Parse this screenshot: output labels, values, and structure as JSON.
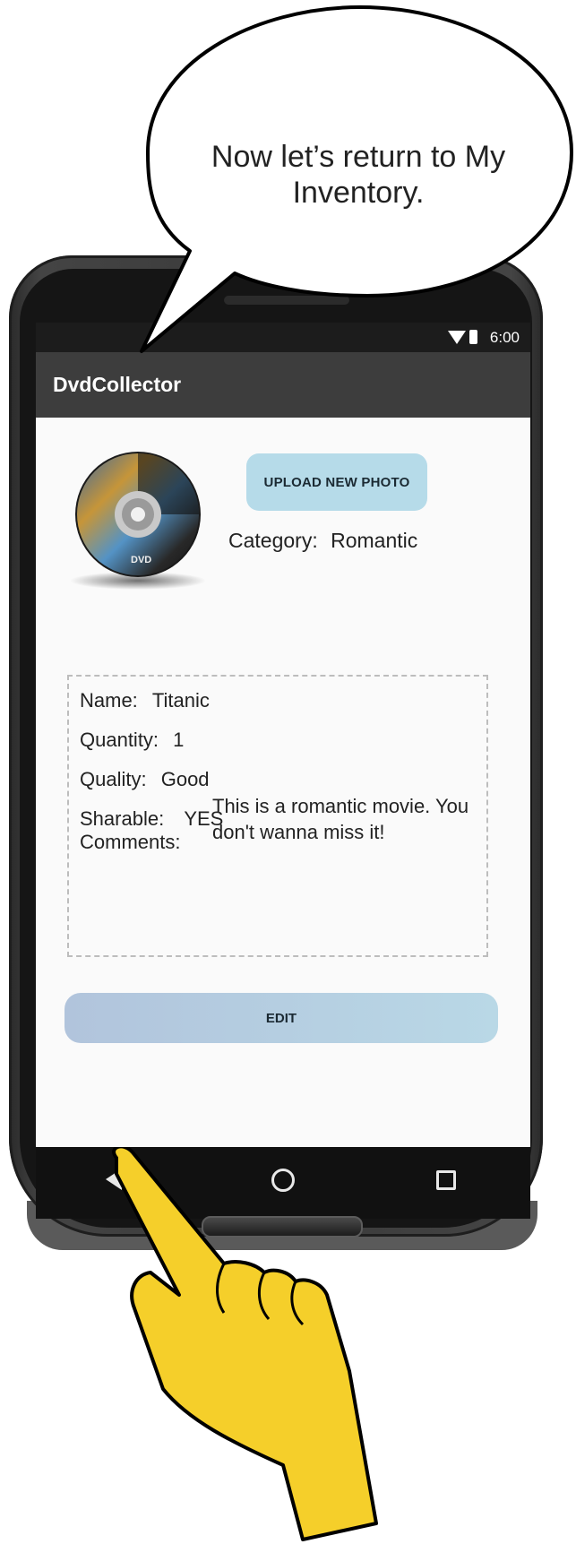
{
  "bubble": {
    "text": "Now let’s return to My Inventory."
  },
  "status_bar": {
    "time": "6:00"
  },
  "app_bar": {
    "title": "DvdCollector"
  },
  "photo": {
    "upload_label": "UPLOAD NEW PHOTO",
    "icon": "dvd-disc-icon",
    "disc_label": "DVD"
  },
  "category": {
    "label": "Category:",
    "value": "Romantic"
  },
  "details": {
    "name": {
      "label": "Name:",
      "value": "Titanic"
    },
    "quantity": {
      "label": "Quantity:",
      "value": "1"
    },
    "quality": {
      "label": "Quality:",
      "value": "Good"
    },
    "sharable": {
      "label": "Sharable:",
      "value": "YES"
    },
    "comments": {
      "label": "Comments:",
      "value": "This is a romantic movie. You don't wanna miss it!"
    }
  },
  "edit_label": "EDIT",
  "nav_bar": {
    "back": "back-icon",
    "home": "home-icon",
    "recents": "recents-icon"
  },
  "colors": {
    "app_bar": "#3d3d3d",
    "upload_button": "#b6dbe9",
    "edit_button": "#b1c4dc",
    "hand": "#f5cf2a"
  }
}
